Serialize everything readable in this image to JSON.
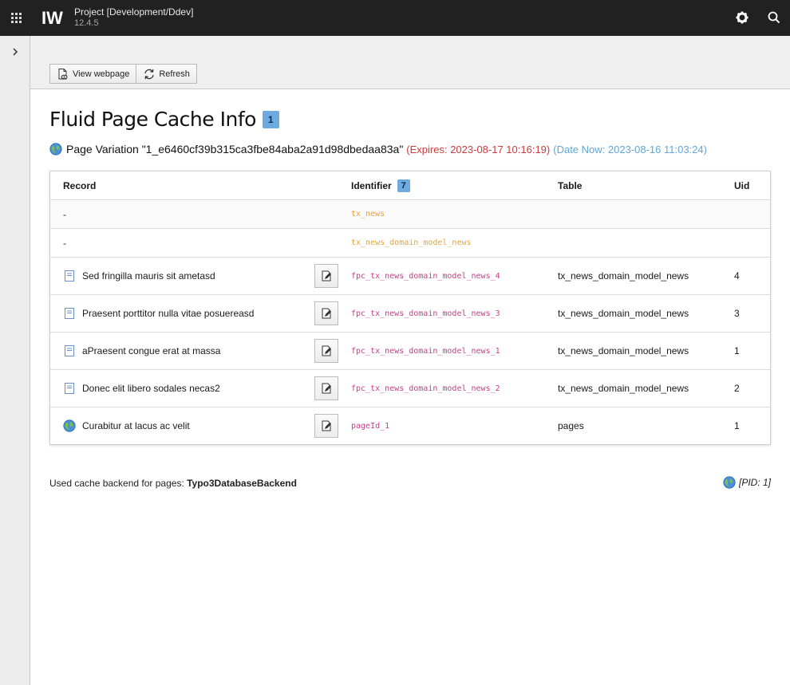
{
  "topbar": {
    "site_name": "Project [Development/Ddev]",
    "version": "12.4.5",
    "icons": [
      "apps-grid-icon",
      "typo3-logo",
      "gear-icon",
      "search-icon"
    ]
  },
  "docheader": {
    "view_webpage_label": "View webpage",
    "refresh_label": "Refresh"
  },
  "main": {
    "title": "Fluid Page Cache Info",
    "title_badge": "1",
    "variation": {
      "label": "Page Variation \"1_e6460cf39b315ca3fbe84aba2a91d98dbedaa83a\"",
      "expires": "(Expires: 2023-08-17 10:16:19)",
      "date_now": "(Date Now: 2023-08-16 11:03:24)"
    }
  },
  "table": {
    "headers": {
      "record": "Record",
      "identifier": "Identifier",
      "identifier_badge": "7",
      "table": "Table",
      "uid": "Uid"
    },
    "tag_rows": [
      {
        "record": "-",
        "identifier": "tx_news"
      },
      {
        "record": "-",
        "identifier": "tx_news_domain_model_news"
      }
    ],
    "record_rows": [
      {
        "icon": "document-icon",
        "record": "Sed fringilla mauris sit ametasd",
        "identifier": "fpc_tx_news_domain_model_news_4",
        "table": "tx_news_domain_model_news",
        "uid": "4"
      },
      {
        "icon": "document-icon",
        "record": "Praesent porttitor nulla vitae posuereasd",
        "identifier": "fpc_tx_news_domain_model_news_3",
        "table": "tx_news_domain_model_news",
        "uid": "3"
      },
      {
        "icon": "document-icon",
        "record": "aPraesent congue erat at massa",
        "identifier": "fpc_tx_news_domain_model_news_1",
        "table": "tx_news_domain_model_news",
        "uid": "1"
      },
      {
        "icon": "document-icon",
        "record": "Donec elit libero sodales necas2",
        "identifier": "fpc_tx_news_domain_model_news_2",
        "table": "tx_news_domain_model_news",
        "uid": "2"
      },
      {
        "icon": "globe-icon",
        "record": "Curabitur at lacus ac velit",
        "identifier": "pageId_1",
        "table": "pages",
        "uid": "1"
      }
    ]
  },
  "footer": {
    "backend_label": "Used cache backend for pages: ",
    "backend_value": "Typo3DatabaseBackend",
    "pid": "[PID: 1]"
  },
  "colors": {
    "topbar_bg": "#212121",
    "badge": "#6daae0",
    "expires": "#c83c3c",
    "date_now": "#5fa7d8",
    "tag_identifier": "#e8a23d",
    "record_identifier": "#c83c8c"
  }
}
